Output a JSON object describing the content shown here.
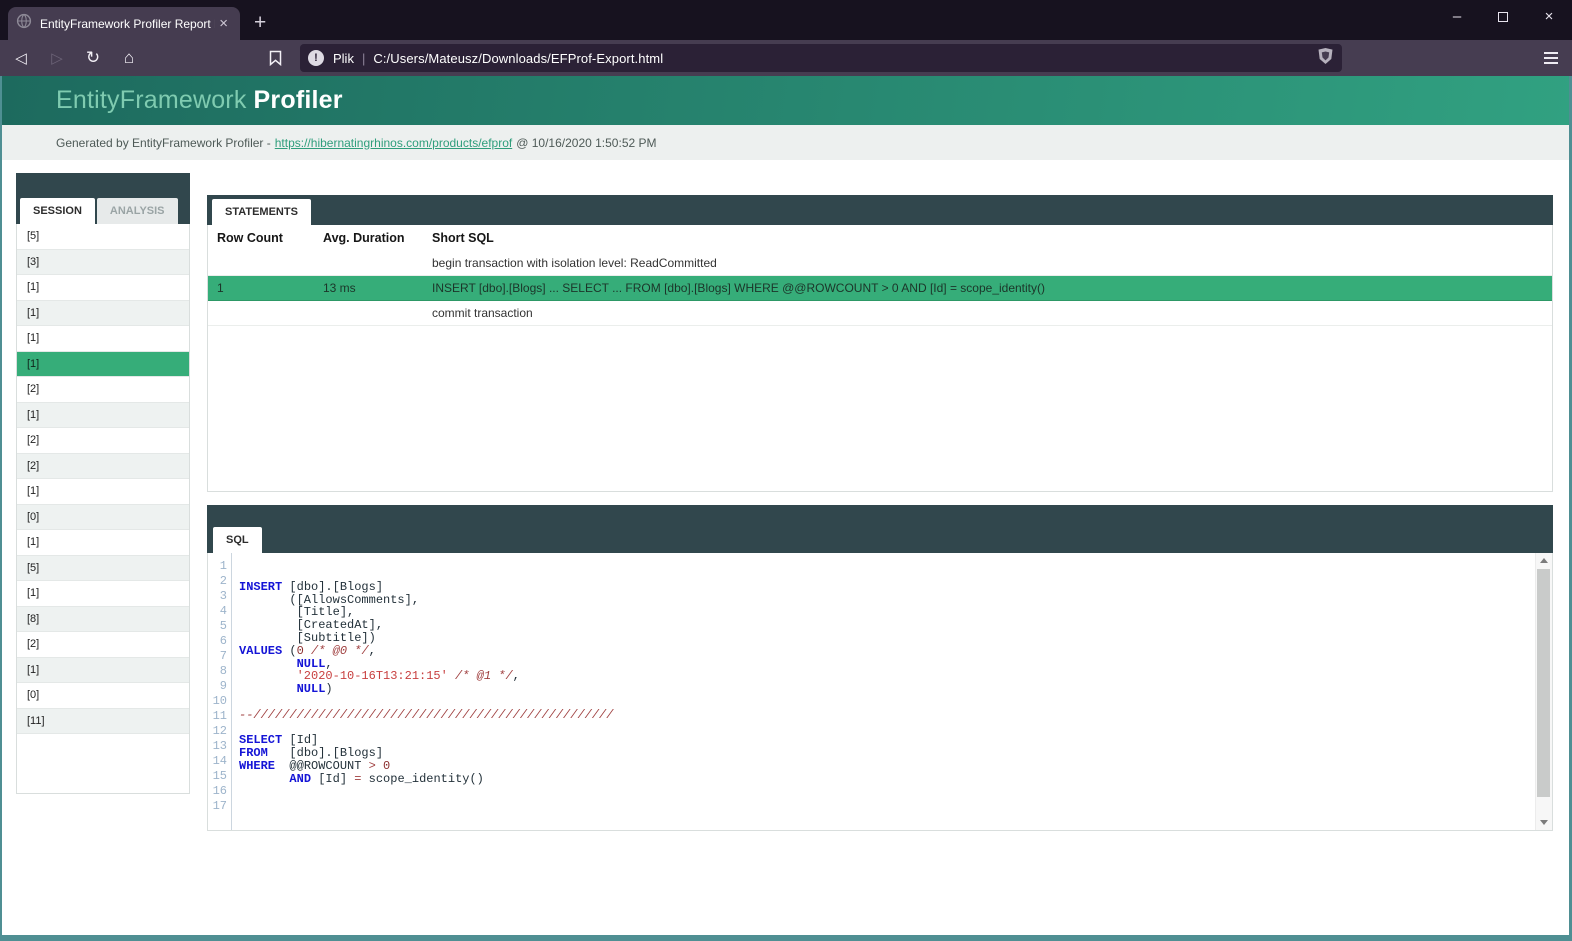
{
  "theme": {
    "accent_green": "#36ad79",
    "panel_dark": "#31474d",
    "brand_grad_a": "#1d6a5e",
    "brand_grad_b": "#31a181",
    "page_frame": "#4f8f93"
  },
  "browser": {
    "tab_title": "EntityFramework Profiler Report Ex",
    "tab_close": "×",
    "new_tab": "+",
    "minimize": "–",
    "close": "×",
    "scheme_label": "Plik",
    "url_separator": "|",
    "url": "C:/Users/Mateusz/Downloads/EFProf-Export.html",
    "back": "◁",
    "forward": "▷",
    "reload": "↻",
    "home": "⌂",
    "info_glyph": "!"
  },
  "header": {
    "brand_light": "EntityFramework",
    "brand_bold": "Profiler"
  },
  "subheader": {
    "prefix": "Generated by EntityFramework Profiler -",
    "link": "https://hibernatingrhinos.com/products/efprof",
    "suffix": "@ 10/16/2020 1:50:52 PM"
  },
  "sidebar": {
    "tabs": [
      {
        "label": "SESSION"
      },
      {
        "label": "ANALYSIS"
      }
    ],
    "items": [
      "[5]",
      "[3]",
      "[1]",
      "[1]",
      "[1]",
      "[1]",
      "[2]",
      "[1]",
      "[2]",
      "[2]",
      "[1]",
      "[0]",
      "[1]",
      "[5]",
      "[1]",
      "[8]",
      "[2]",
      "[1]",
      "[0]",
      "[11]"
    ],
    "selected_index": 5
  },
  "statements": {
    "tab_label": "STATEMENTS",
    "columns": [
      "Row Count",
      "Avg. Duration",
      "Short SQL"
    ],
    "rows": [
      {
        "row_count": "",
        "avg_duration": "",
        "short_sql": "begin transaction with isolation level: ReadCommitted",
        "selected": false
      },
      {
        "row_count": "1",
        "avg_duration": "13 ms",
        "short_sql": "INSERT [dbo].[Blogs] ... SELECT ... FROM [dbo].[Blogs] WHERE @@ROWCOUNT > 0 AND [Id] = scope_identity()",
        "selected": true
      },
      {
        "row_count": "",
        "avg_duration": "",
        "short_sql": "commit transaction",
        "selected": false
      }
    ]
  },
  "sql_viewer": {
    "tab_label": "SQL",
    "line_count": 17,
    "lines": [
      [],
      [
        [
          "kw",
          "INSERT"
        ],
        [
          "pl",
          " [dbo].[Blogs]"
        ]
      ],
      [
        [
          "pl",
          "       ([AllowsComments],"
        ]
      ],
      [
        [
          "pl",
          "        [Title],"
        ]
      ],
      [
        [
          "pl",
          "        [CreatedAt],"
        ]
      ],
      [
        [
          "pl",
          "        [Subtitle])"
        ]
      ],
      [
        [
          "kw",
          "VALUES"
        ],
        [
          "pl",
          " ("
        ],
        [
          "num",
          "0"
        ],
        [
          "pl",
          " "
        ],
        [
          "com",
          "/* @0 */"
        ],
        [
          "pl",
          ","
        ]
      ],
      [
        [
          "pl",
          "        "
        ],
        [
          "kw",
          "NULL"
        ],
        [
          "pl",
          ","
        ]
      ],
      [
        [
          "pl",
          "        "
        ],
        [
          "str",
          "'2020-10-16T13:21:15'"
        ],
        [
          "pl",
          " "
        ],
        [
          "com",
          "/* @1 */"
        ],
        [
          "pl",
          ","
        ]
      ],
      [
        [
          "pl",
          "        "
        ],
        [
          "kw",
          "NULL"
        ],
        [
          "pl",
          ")"
        ]
      ],
      [],
      [
        [
          "com",
          "--//////////////////////////////////////////////////"
        ]
      ],
      [],
      [
        [
          "kw",
          "SELECT"
        ],
        [
          "pl",
          " [Id]"
        ]
      ],
      [
        [
          "kw",
          "FROM"
        ],
        [
          "pl",
          "   [dbo].[Blogs]"
        ]
      ],
      [
        [
          "kw",
          "WHERE"
        ],
        [
          "pl",
          "  @@ROWCOUNT "
        ],
        [
          "op",
          ">"
        ],
        [
          "pl",
          " "
        ],
        [
          "num",
          "0"
        ]
      ],
      [
        [
          "pl",
          "       "
        ],
        [
          "kw",
          "AND"
        ],
        [
          "pl",
          " [Id] "
        ],
        [
          "op",
          "="
        ],
        [
          "pl",
          " scope_identity()"
        ]
      ]
    ]
  }
}
